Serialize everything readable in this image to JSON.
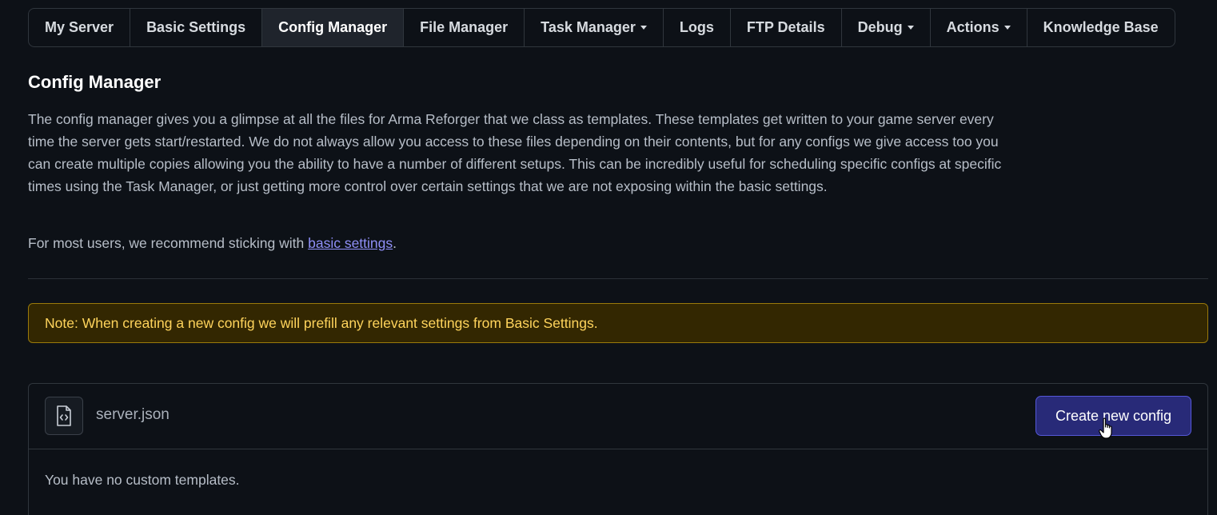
{
  "tabs": [
    {
      "label": "My Server"
    },
    {
      "label": "Basic Settings"
    },
    {
      "label": "Config Manager"
    },
    {
      "label": "File Manager"
    },
    {
      "label": "Task Manager"
    },
    {
      "label": "Logs"
    },
    {
      "label": "FTP Details"
    },
    {
      "label": "Debug"
    },
    {
      "label": "Actions"
    },
    {
      "label": "Knowledge Base"
    }
  ],
  "page": {
    "title": "Config Manager",
    "description": "The config manager gives you a glimpse at all the files for Arma Reforger that we class as templates. These templates get written to your game server every time the server gets start/restarted. We do not always allow you access to these files depending on their contents, but for any configs we give access too you can create multiple copies allowing you the ability to have a number of different setups. This can be incredibly useful for scheduling specific configs at specific times using the Task Manager, or just getting more control over certain settings that we are not exposing within the basic settings.",
    "recommend_prefix": "For most users, we recommend sticking with ",
    "recommend_link": "basic settings",
    "recommend_suffix": "."
  },
  "note": {
    "text": "Note: When creating a new config we will prefill any relevant settings from Basic Settings."
  },
  "config_card": {
    "file_icon": "file-code-icon",
    "file_name": "server.json",
    "create_button": "Create new config",
    "empty_message": "You have no custom templates."
  },
  "colors": {
    "background": "#0d1117",
    "accent_button": "#282a78",
    "link": "#8f8ff7",
    "note_bg": "#332701",
    "note_text": "#ffd45c"
  }
}
